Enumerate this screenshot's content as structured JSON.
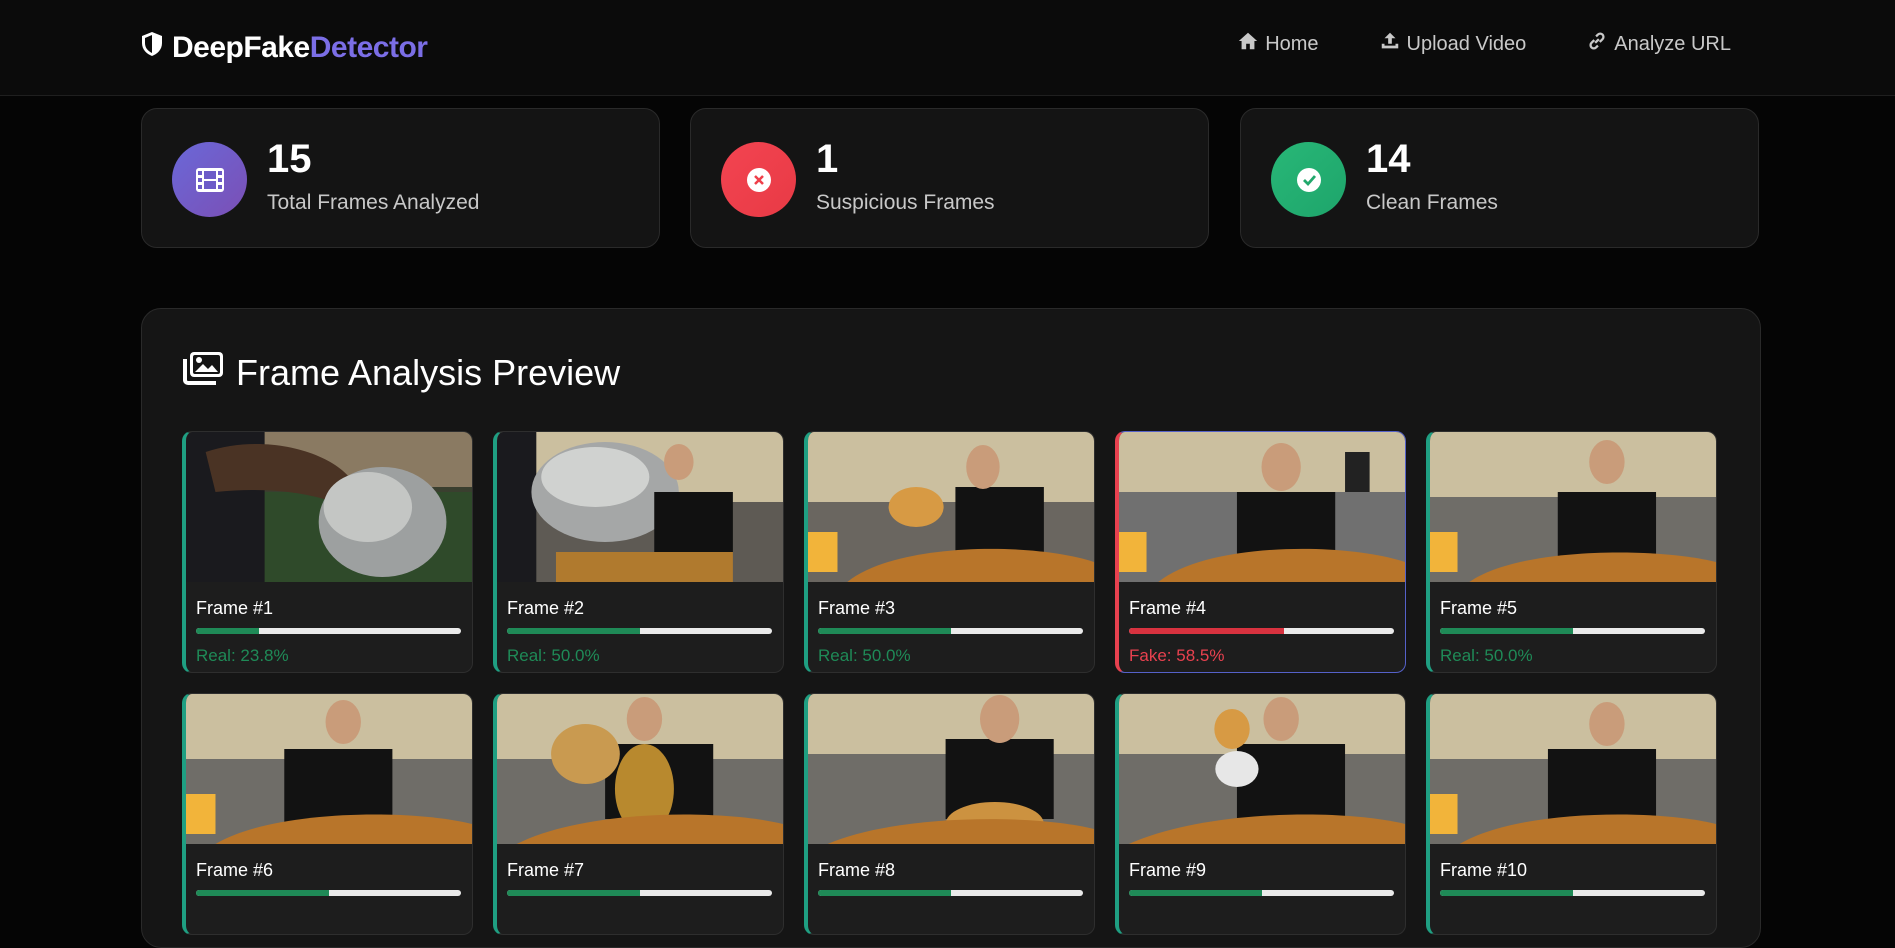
{
  "brand": {
    "name_part1": "DeepFake",
    "name_part2": "Detector"
  },
  "nav": [
    {
      "label": "Home",
      "icon": "home-icon"
    },
    {
      "label": "Upload Video",
      "icon": "upload-icon"
    },
    {
      "label": "Analyze URL",
      "icon": "link-icon"
    }
  ],
  "stats": [
    {
      "value": "15",
      "label": "Total Frames Analyzed",
      "icon": "film-icon",
      "color": "#6f5bd0"
    },
    {
      "value": "1",
      "label": "Suspicious Frames",
      "icon": "x-circle-icon",
      "color": "#f0404a"
    },
    {
      "value": "14",
      "label": "Clean Frames",
      "icon": "check-circle-icon",
      "color": "#22b07a"
    }
  ],
  "panel": {
    "title": "Frame Analysis Preview",
    "icon": "images-icon"
  },
  "colors": {
    "real": "#1f9f82",
    "fake": "#e8414f",
    "real_bar": "#1f8a57",
    "fake_bar": "#d8323f"
  },
  "frames": [
    {
      "title": "Frame #1",
      "status": "Real: 23.8%",
      "verdict": "real",
      "score": 0.238
    },
    {
      "title": "Frame #2",
      "status": "Real: 50.0%",
      "verdict": "real",
      "score": 0.5
    },
    {
      "title": "Frame #3",
      "status": "Real: 50.0%",
      "verdict": "real",
      "score": 0.5
    },
    {
      "title": "Frame #4",
      "status": "Fake: 58.5%",
      "verdict": "fake",
      "score": 0.585
    },
    {
      "title": "Frame #5",
      "status": "Real: 50.0%",
      "verdict": "real",
      "score": 0.5
    },
    {
      "title": "Frame #6",
      "status": "",
      "verdict": "real",
      "score": 0.5
    },
    {
      "title": "Frame #7",
      "status": "",
      "verdict": "real",
      "score": 0.5
    },
    {
      "title": "Frame #8",
      "status": "",
      "verdict": "real",
      "score": 0.5
    },
    {
      "title": "Frame #9",
      "status": "",
      "verdict": "real",
      "score": 0.5
    },
    {
      "title": "Frame #10",
      "status": "",
      "verdict": "real",
      "score": 0.5
    }
  ]
}
